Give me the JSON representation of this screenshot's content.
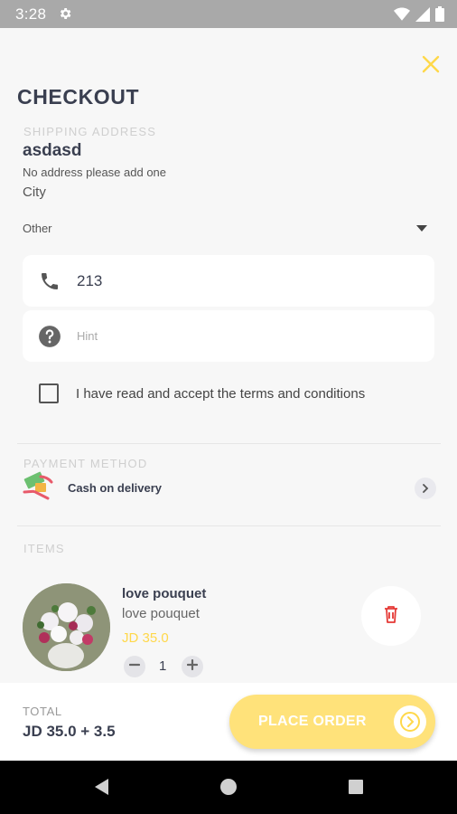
{
  "status_bar": {
    "time": "3:28"
  },
  "header": {
    "title": "CHECKOUT"
  },
  "shipping": {
    "section_label": "SHIPPING ADDRESS",
    "name": "asdasd",
    "address_line": "No address please add one",
    "city": "City",
    "address_type": "Other"
  },
  "phone": {
    "value": "213"
  },
  "hint": {
    "placeholder": "Hint"
  },
  "terms": {
    "label": "I have read and accept the terms and conditions"
  },
  "payment": {
    "section_label": "PAYMENT METHOD",
    "method": "Cash on delivery"
  },
  "items": {
    "section_label": "ITEMS",
    "list": [
      {
        "name": "love pouquet",
        "description": "love pouquet",
        "price": "JD 35.0",
        "quantity": "1"
      }
    ]
  },
  "footer": {
    "total_label": "TOTAL",
    "total_value": "JD 35.0 + 3.5",
    "place_order_label": "PLACE ORDER"
  },
  "colors": {
    "accent": "#ffd84a",
    "button": "#ffe27a",
    "delete": "#e53935",
    "text": "#3a3f50"
  }
}
